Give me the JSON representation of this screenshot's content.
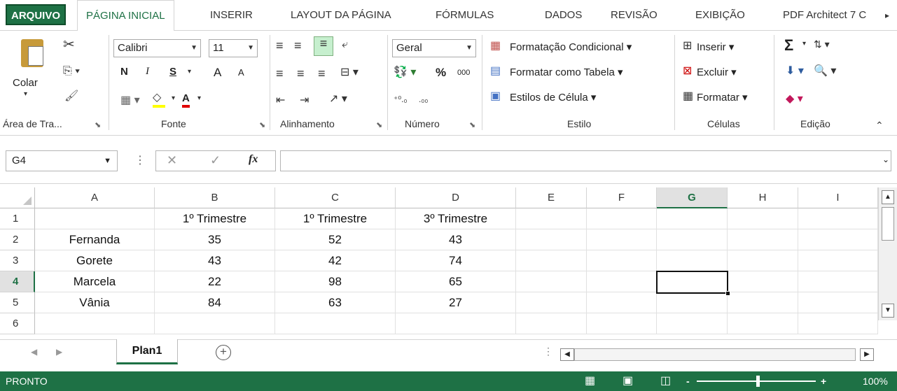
{
  "tabs": {
    "file": "ARQUIVO",
    "home": "PÁGINA INICIAL",
    "insert": "INSERIR",
    "layout": "LAYOUT DA PÁGINA",
    "formulas": "FÓRMULAS",
    "data": "DADOS",
    "review": "REVISÃO",
    "view": "EXIBIÇÃO",
    "pdf": "PDF Architect 7 C"
  },
  "clipboard": {
    "paste": "Colar",
    "label": "Área de Tra..."
  },
  "font": {
    "name": "Calibri",
    "size": "11",
    "bold": "N",
    "italic": "I",
    "underline": "S",
    "grow": "A",
    "shrink": "A",
    "color_a": "A",
    "label": "Fonte"
  },
  "alignment": {
    "label": "Alinhamento"
  },
  "number": {
    "format": "Geral",
    "percent": "%",
    "thousands": "000",
    "label": "Número"
  },
  "styles": {
    "conditional": "Formatação Condicional",
    "table": "Formatar como Tabela",
    "cell_styles": "Estilos de Célula",
    "label": "Estilo"
  },
  "cells": {
    "insert": "Inserir",
    "delete": "Excluir",
    "format": "Formatar",
    "label": "Células"
  },
  "editing": {
    "sum": "Σ",
    "label": "Edição"
  },
  "formula_bar": {
    "name_box": "G4",
    "fx": "fx",
    "formula": ""
  },
  "columns": [
    "A",
    "B",
    "C",
    "D",
    "E",
    "F",
    "G",
    "H",
    "I"
  ],
  "rows": [
    "1",
    "2",
    "3",
    "4",
    "5",
    "6"
  ],
  "table": {
    "header": [
      "",
      "1º Trimestre",
      "1º Trimestre",
      "3º Trimestre"
    ],
    "data": [
      [
        "Fernanda",
        "35",
        "52",
        "43"
      ],
      [
        "Gorete",
        "43",
        "42",
        "74"
      ],
      [
        "Marcela",
        "22",
        "98",
        "65"
      ],
      [
        "Vânia",
        "84",
        "63",
        "27"
      ]
    ]
  },
  "sheet": {
    "name": "Plan1",
    "add": "+"
  },
  "status": {
    "text": "PRONTO",
    "zoom": "100%",
    "minus": "-",
    "plus": "+"
  },
  "colors": {
    "accent": "#1e7145"
  }
}
